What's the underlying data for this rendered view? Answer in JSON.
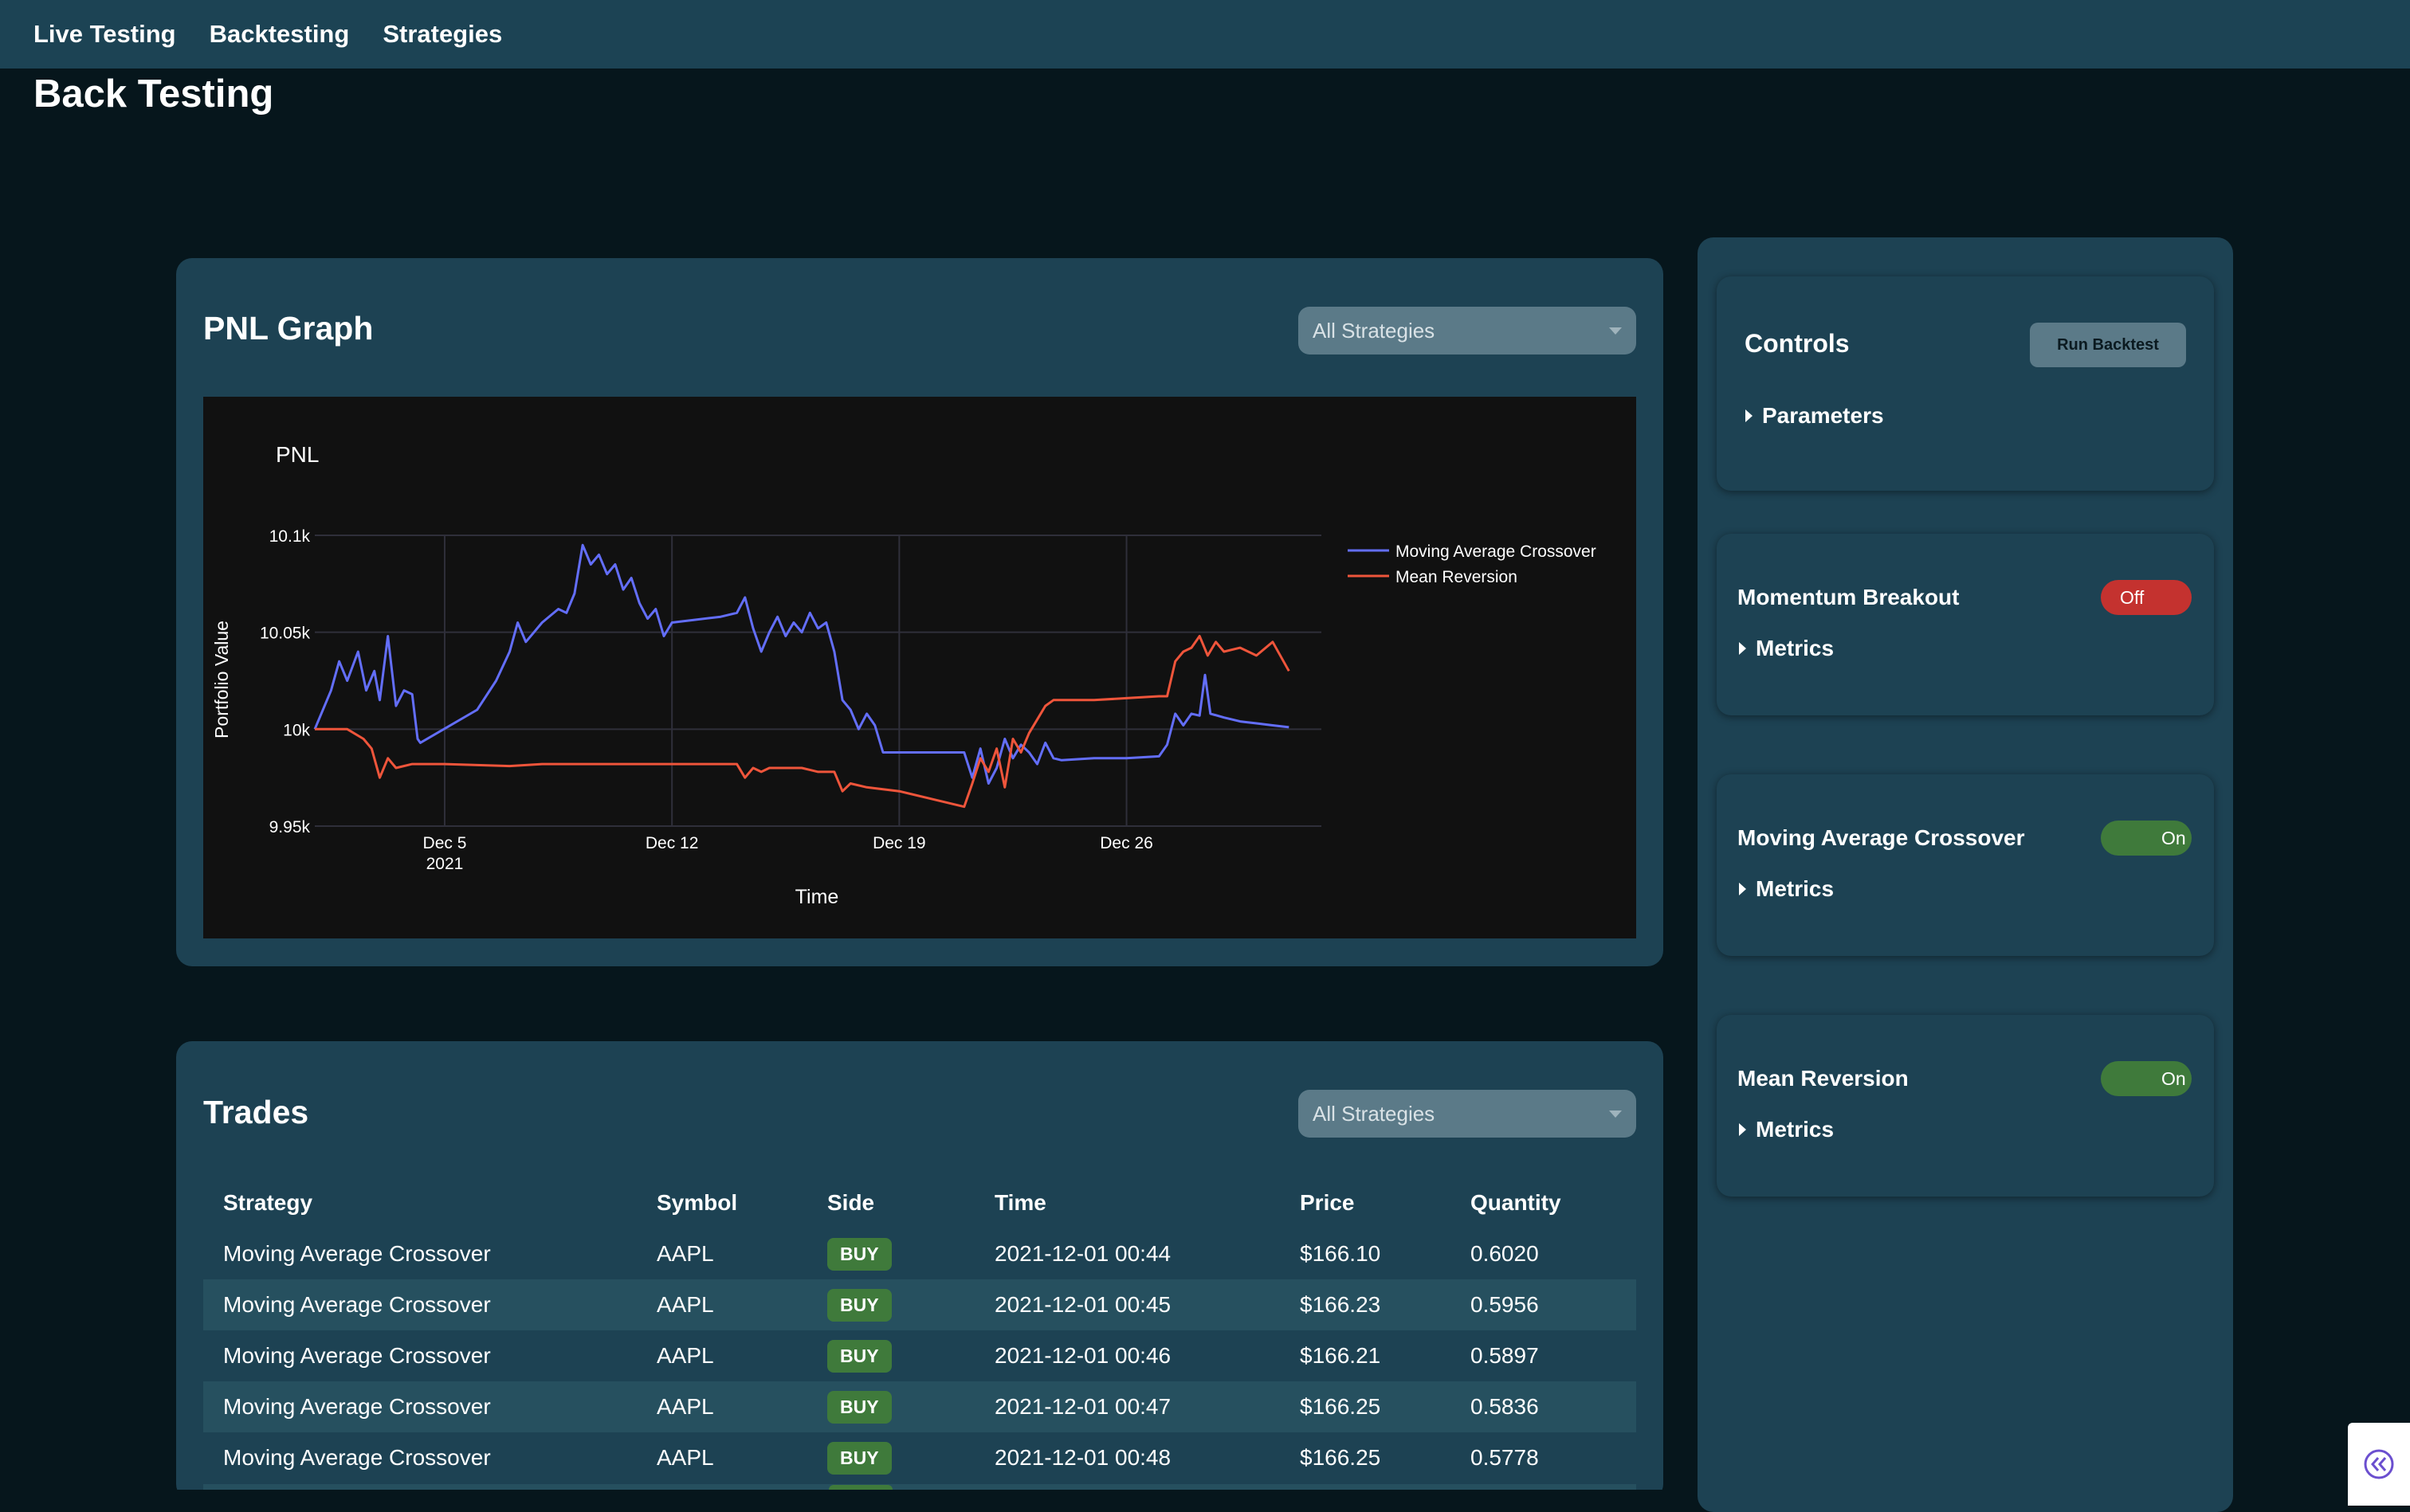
{
  "nav": {
    "items": [
      {
        "label": "Live Testing"
      },
      {
        "label": "Backtesting"
      },
      {
        "label": "Strategies"
      }
    ]
  },
  "page": {
    "title": "Back Testing"
  },
  "pnl": {
    "title": "PNL Graph",
    "filter": {
      "selected": "All Strategies"
    }
  },
  "trades": {
    "title": "Trades",
    "filter": {
      "selected": "All Strategies"
    },
    "columns": [
      "Strategy",
      "Symbol",
      "Side",
      "Time",
      "Price",
      "Quantity"
    ],
    "rows": [
      [
        "Moving Average Crossover",
        "AAPL",
        "BUY",
        "2021-12-01 00:44",
        "$166.10",
        "0.6020"
      ],
      [
        "Moving Average Crossover",
        "AAPL",
        "BUY",
        "2021-12-01 00:45",
        "$166.23",
        "0.5956"
      ],
      [
        "Moving Average Crossover",
        "AAPL",
        "BUY",
        "2021-12-01 00:46",
        "$166.21",
        "0.5897"
      ],
      [
        "Moving Average Crossover",
        "AAPL",
        "BUY",
        "2021-12-01 00:47",
        "$166.25",
        "0.5836"
      ],
      [
        "Moving Average Crossover",
        "AAPL",
        "BUY",
        "2021-12-01 00:48",
        "$166.25",
        "0.5778"
      ]
    ]
  },
  "controls": {
    "title": "Controls",
    "run_label": "Run Backtest",
    "parameters_label": "Parameters"
  },
  "strategies": [
    {
      "name": "Momentum Breakout",
      "state": "Off",
      "metrics_label": "Metrics"
    },
    {
      "name": "Moving Average Crossover",
      "state": "On",
      "metrics_label": "Metrics"
    },
    {
      "name": "Mean Reversion",
      "state": "On",
      "metrics_label": "Metrics"
    }
  ],
  "colors": {
    "nav_bg": "#1c4354",
    "page_bg": "#06161c",
    "card_bg": "#1d4253",
    "series_mac": "#636efa",
    "series_mr": "#ef553b",
    "toggle_on": "#3f7a3b",
    "toggle_off": "#c4322f"
  },
  "icons": {
    "collapse": "double-chevron-left-icon"
  },
  "chart_data": {
    "type": "line",
    "title": "PNL",
    "xlabel": "Time",
    "ylabel": "Portfolio Value",
    "x_ticks": [
      {
        "date": "2021-12-05",
        "label": "Dec 5",
        "sublabel": "2021"
      },
      {
        "date": "2021-12-12",
        "label": "Dec 12"
      },
      {
        "date": "2021-12-19",
        "label": "Dec 19"
      },
      {
        "date": "2021-12-26",
        "label": "Dec 26"
      }
    ],
    "y_ticks": [
      {
        "value": 9950,
        "label": "9.95k"
      },
      {
        "value": 10000,
        "label": "10k"
      },
      {
        "value": 10050,
        "label": "10.05k"
      },
      {
        "value": 10100,
        "label": "10.1k"
      }
    ],
    "xlim": [
      "2021-12-01",
      "2022-01-01"
    ],
    "ylim": [
      9950,
      10100
    ],
    "grid": true,
    "legend_position": "top-right",
    "series": [
      {
        "name": "Moving Average Crossover",
        "color": "#636efa",
        "points": [
          [
            "2021-12-01",
            10000
          ],
          [
            "2021-12-01T12",
            10020
          ],
          [
            "2021-12-01T18",
            10035
          ],
          [
            "2021-12-02",
            10025
          ],
          [
            "2021-12-02T08",
            10040
          ],
          [
            "2021-12-02T14",
            10020
          ],
          [
            "2021-12-02T20",
            10030
          ],
          [
            "2021-12-03",
            10015
          ],
          [
            "2021-12-03T06",
            10048
          ],
          [
            "2021-12-03T12",
            10012
          ],
          [
            "2021-12-03T18",
            10020
          ],
          [
            "2021-12-04",
            10018
          ],
          [
            "2021-12-04T04",
            9995
          ],
          [
            "2021-12-04T06",
            9993
          ],
          [
            "2021-12-06",
            10010
          ],
          [
            "2021-12-06T14",
            10025
          ],
          [
            "2021-12-07",
            10040
          ],
          [
            "2021-12-07T06",
            10055
          ],
          [
            "2021-12-07T12",
            10045
          ],
          [
            "2021-12-07T18",
            10050
          ],
          [
            "2021-12-08",
            10055
          ],
          [
            "2021-12-08T12",
            10062
          ],
          [
            "2021-12-08T18",
            10060
          ],
          [
            "2021-12-09",
            10070
          ],
          [
            "2021-12-09T06",
            10095
          ],
          [
            "2021-12-09T12",
            10085
          ],
          [
            "2021-12-09T18",
            10090
          ],
          [
            "2021-12-10",
            10080
          ],
          [
            "2021-12-10T06",
            10085
          ],
          [
            "2021-12-10T12",
            10072
          ],
          [
            "2021-12-10T18",
            10078
          ],
          [
            "2021-12-11",
            10065
          ],
          [
            "2021-12-11T06",
            10057
          ],
          [
            "2021-12-11T12",
            10062
          ],
          [
            "2021-12-11T18",
            10048
          ],
          [
            "2021-12-12",
            10055
          ],
          [
            "2021-12-13T12",
            10058
          ],
          [
            "2021-12-14",
            10060
          ],
          [
            "2021-12-14T06",
            10068
          ],
          [
            "2021-12-14T12",
            10052
          ],
          [
            "2021-12-14T18",
            10040
          ],
          [
            "2021-12-15",
            10050
          ],
          [
            "2021-12-15T06",
            10058
          ],
          [
            "2021-12-15T12",
            10048
          ],
          [
            "2021-12-15T18",
            10055
          ],
          [
            "2021-12-16",
            10050
          ],
          [
            "2021-12-16T06",
            10060
          ],
          [
            "2021-12-16T12",
            10052
          ],
          [
            "2021-12-16T18",
            10055
          ],
          [
            "2021-12-17",
            10040
          ],
          [
            "2021-12-17T06",
            10015
          ],
          [
            "2021-12-17T12",
            10010
          ],
          [
            "2021-12-17T18",
            10000
          ],
          [
            "2021-12-18",
            10008
          ],
          [
            "2021-12-18T06",
            10002
          ],
          [
            "2021-12-18T12",
            9988
          ],
          [
            "2021-12-21",
            9988
          ],
          [
            "2021-12-21T06",
            9975
          ],
          [
            "2021-12-21T12",
            9990
          ],
          [
            "2021-12-21T18",
            9972
          ],
          [
            "2021-12-22",
            9980
          ],
          [
            "2021-12-22T06",
            9995
          ],
          [
            "2021-12-22T12",
            9985
          ],
          [
            "2021-12-22T18",
            9992
          ],
          [
            "2021-12-23",
            9988
          ],
          [
            "2021-12-23T06",
            9982
          ],
          [
            "2021-12-23T12",
            9993
          ],
          [
            "2021-12-23T18",
            9985
          ],
          [
            "2021-12-24",
            9984
          ],
          [
            "2021-12-25",
            9985
          ],
          [
            "2021-12-26",
            9985
          ],
          [
            "2021-12-27",
            9986
          ],
          [
            "2021-12-27T06",
            9992
          ],
          [
            "2021-12-27T12",
            10008
          ],
          [
            "2021-12-27T18",
            10002
          ],
          [
            "2021-12-28",
            10008
          ],
          [
            "2021-12-28T06",
            10007
          ],
          [
            "2021-12-28T10",
            10028
          ],
          [
            "2021-12-28T14",
            10008
          ],
          [
            "2021-12-29",
            10006
          ],
          [
            "2021-12-29T12",
            10004
          ],
          [
            "2021-12-30",
            10003
          ],
          [
            "2021-12-30T12",
            10002
          ],
          [
            "2021-12-31",
            10001
          ]
        ]
      },
      {
        "name": "Mean Reversion",
        "color": "#ef553b",
        "points": [
          [
            "2021-12-01",
            10000
          ],
          [
            "2021-12-02",
            10000
          ],
          [
            "2021-12-02T12",
            9995
          ],
          [
            "2021-12-02T18",
            9990
          ],
          [
            "2021-12-03",
            9975
          ],
          [
            "2021-12-03T06",
            9985
          ],
          [
            "2021-12-03T12",
            9980
          ],
          [
            "2021-12-04",
            9982
          ],
          [
            "2021-12-05",
            9982
          ],
          [
            "2021-12-07",
            9981
          ],
          [
            "2021-12-08",
            9982
          ],
          [
            "2021-12-09",
            9982
          ],
          [
            "2021-12-10",
            9982
          ],
          [
            "2021-12-11",
            9982
          ],
          [
            "2021-12-12",
            9982
          ],
          [
            "2021-12-13",
            9982
          ],
          [
            "2021-12-14",
            9982
          ],
          [
            "2021-12-14T06",
            9975
          ],
          [
            "2021-12-14T12",
            9980
          ],
          [
            "2021-12-14T18",
            9978
          ],
          [
            "2021-12-15",
            9980
          ],
          [
            "2021-12-16",
            9980
          ],
          [
            "2021-12-16T12",
            9978
          ],
          [
            "2021-12-17",
            9978
          ],
          [
            "2021-12-17T06",
            9968
          ],
          [
            "2021-12-17T12",
            9972
          ],
          [
            "2021-12-18",
            9970
          ],
          [
            "2021-12-19",
            9968
          ],
          [
            "2021-12-20",
            9964
          ],
          [
            "2021-12-21",
            9960
          ],
          [
            "2021-12-21T06",
            9972
          ],
          [
            "2021-12-21T12",
            9985
          ],
          [
            "2021-12-21T18",
            9978
          ],
          [
            "2021-12-22",
            9990
          ],
          [
            "2021-12-22T06",
            9970
          ],
          [
            "2021-12-22T12",
            9995
          ],
          [
            "2021-12-22T18",
            9988
          ],
          [
            "2021-12-23",
            9998
          ],
          [
            "2021-12-23T06",
            10005
          ],
          [
            "2021-12-23T12",
            10012
          ],
          [
            "2021-12-23T18",
            10015
          ],
          [
            "2021-12-24",
            10015
          ],
          [
            "2021-12-25",
            10015
          ],
          [
            "2021-12-26",
            10016
          ],
          [
            "2021-12-27",
            10017
          ],
          [
            "2021-12-27T06",
            10017
          ],
          [
            "2021-12-27T12",
            10035
          ],
          [
            "2021-12-27T18",
            10040
          ],
          [
            "2021-12-28",
            10042
          ],
          [
            "2021-12-28T06",
            10048
          ],
          [
            "2021-12-28T12",
            10038
          ],
          [
            "2021-12-28T18",
            10045
          ],
          [
            "2021-12-29",
            10040
          ],
          [
            "2021-12-29T12",
            10042
          ],
          [
            "2021-12-30",
            10038
          ],
          [
            "2021-12-30T12",
            10045
          ],
          [
            "2021-12-31",
            10030
          ]
        ]
      }
    ]
  }
}
